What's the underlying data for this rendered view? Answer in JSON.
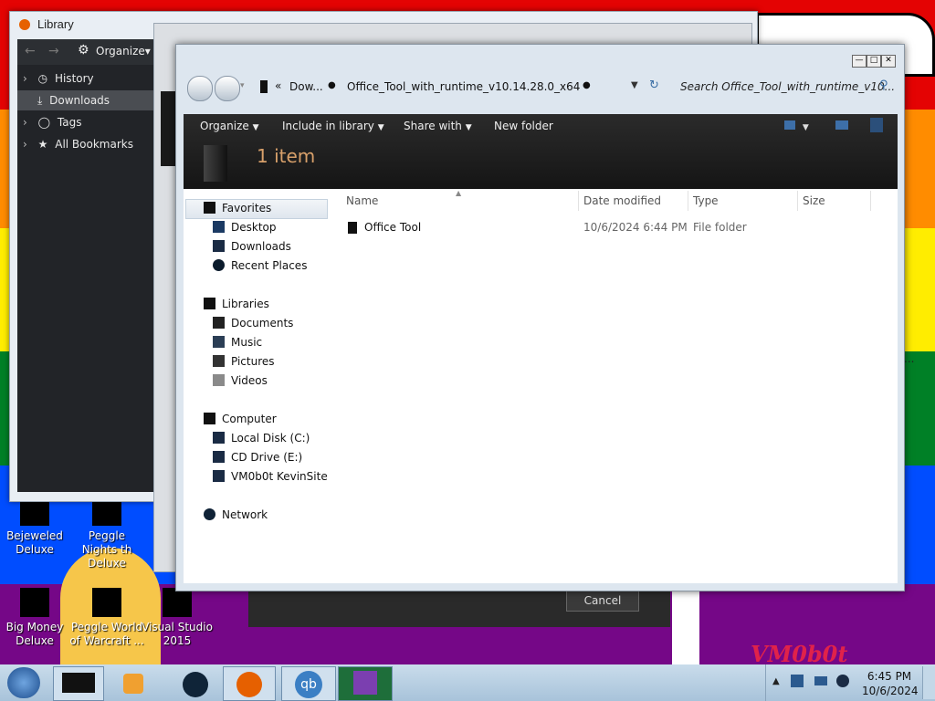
{
  "colors": {
    "stripes": [
      "#e40303",
      "#ff8c00",
      "#ffed00",
      "#008026",
      "#004dff",
      "#750787"
    ],
    "accent_text": "#d8a06a"
  },
  "desktop": {
    "icons": [
      {
        "label_line1": "Bejeweled",
        "label_line2": "Deluxe",
        "icon": "bejeweled-icon"
      },
      {
        "label_line1": "Peggle Nights th",
        "label_line2": "Deluxe",
        "icon": "peggle-nights-icon"
      },
      {
        "label_line1": "Big Money",
        "label_line2": "Deluxe",
        "icon": "big-money-icon"
      },
      {
        "label_line1": "Peggle World",
        "label_line2": "of Warcraft ...",
        "icon": "peggle-world-icon"
      },
      {
        "label_line1": "Visual Studio",
        "label_line2": "2015",
        "icon": "visual-studio-icon"
      }
    ],
    "watermark": "VM0b0t",
    "ellipsis": "..."
  },
  "library": {
    "title": "Library",
    "organize": "Organize",
    "items": [
      {
        "label": "History",
        "icon": "clock-icon"
      },
      {
        "label": "Downloads",
        "icon": "download-icon"
      },
      {
        "label": "Tags",
        "icon": "tag-icon"
      },
      {
        "label": "All Bookmarks",
        "icon": "star-icon"
      }
    ]
  },
  "dialog": {
    "cancel": "Cancel"
  },
  "explorer": {
    "breadcrumb_prefix": "«",
    "breadcrumb_1": "Dow...",
    "breadcrumb_2": "Office_Tool_with_runtime_v10.14.28.0_x64",
    "search_placeholder": "Search Office_Tool_with_runtime_v10...",
    "toolbar": {
      "organize": "Organize",
      "include": "Include in library",
      "share": "Share with",
      "new_folder": "New folder"
    },
    "item_count": "1 item",
    "nav": {
      "favorites": "Favorites",
      "desktop": "Desktop",
      "downloads": "Downloads",
      "recent": "Recent Places",
      "libraries": "Libraries",
      "documents": "Documents",
      "music": "Music",
      "pictures": "Pictures",
      "videos": "Videos",
      "computer": "Computer",
      "local_disk": "Local Disk (C:)",
      "cd_drive": "CD Drive (E:)",
      "vm_site": "VM0b0t KevinSite",
      "network": "Network"
    },
    "columns": {
      "name": "Name",
      "date": "Date modified",
      "type": "Type",
      "size": "Size"
    },
    "files": [
      {
        "name": "Office Tool",
        "date": "10/6/2024 6:44 PM",
        "type": "File folder",
        "size": ""
      }
    ]
  },
  "taskbar": {
    "time": "6:45 PM",
    "date": "10/6/2024"
  }
}
